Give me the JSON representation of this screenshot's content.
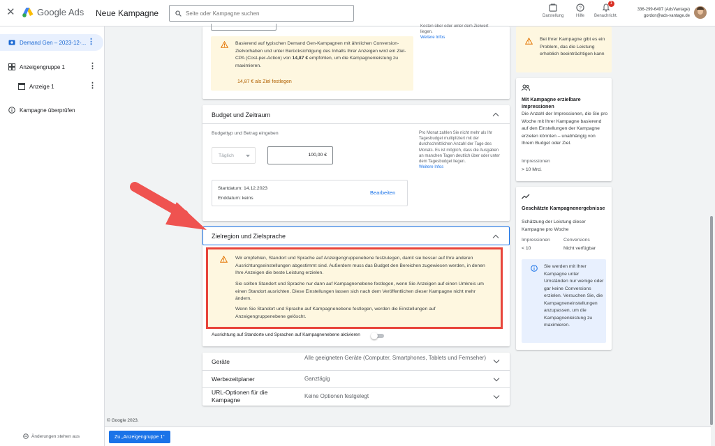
{
  "header": {
    "logo_text": "Google Ads",
    "page_title": "Neue Kampagne",
    "search_placeholder": "Seite oder Kampagne suchen",
    "tools": [
      {
        "label": "Darstellung",
        "icon": "display-icon"
      },
      {
        "label": "Hilfe",
        "icon": "help-icon"
      },
      {
        "label": "Benachricht.",
        "icon": "notifications-icon",
        "badge": "1"
      }
    ],
    "account_id": "336-299-6497 (AdsVantage)",
    "account_email": "gordon@ads-vantage.de"
  },
  "sidebar": {
    "items": [
      {
        "label": "Demand Gen – 2023-12-...",
        "icon": "campaign-icon",
        "active": true
      },
      {
        "label": "Anzeigengruppe 1",
        "icon": "ad-group-icon"
      },
      {
        "label": "Anzeige 1",
        "icon": "ad-icon"
      },
      {
        "label": "Kampagne überprüfen",
        "icon": "info-icon"
      }
    ],
    "footer": "Änderungen stehen aus"
  },
  "bidding": {
    "partial_top_text": "Kosten über oder unter dem Zielwert liegen.",
    "more_info": "Weitere Infos",
    "recommendation_pre": "Basierend auf typischen Demand Gen-Kampagnen mit ähnlichen Conversion-Zielvorhaben und unter Berücksichtigung des Inhalts Ihrer Anzeigen wird ein Ziel-CPA (Cost-per-Action) von",
    "recommendation_value": "14,87 €",
    "recommendation_post": "empfohlen, um die Kampagnenleistung zu maximieren.",
    "set_target_link": "14,87 € als Ziel festlegen"
  },
  "budget": {
    "title": "Budget und Zeitraum",
    "subtitle": "Budgettyp und Betrag eingeben",
    "type_value": "Täglich",
    "amount_value": "100,00 €",
    "side_help": "Pro Monat zahlen Sie nicht mehr als Ihr Tagesbudget multipliziert mit der durchschnittlichen Anzahl der Tage des Monats. Es ist möglich, dass die Ausgaben an manchen Tagen deutlich über oder unter dem Tagesbudget liegen.",
    "more_info": "Weitere Infos",
    "start_date": "Startdatum: 14.12.2023",
    "end_date": "Enddatum: keins",
    "edit_button": "Bearbeiten"
  },
  "targeting": {
    "title": "Zielregion und Zielsprache",
    "warning_p1": "Wir empfehlen, Standort und Sprache auf Anzeigengruppenebene festzulegen, damit sie besser auf Ihre anderen Ausrichtungseinstellungen abgestimmt sind. Außerdem muss das Budget den Bereichen zugewiesen werden, in denen Ihre Anzeigen die beste Leistung erzielen.",
    "warning_p2": "Sie sollten Standort und Sprache nur dann auf Kampagnenebene festlegen, wenn Sie Anzeigen auf einen Umkreis um einen Standort ausrichten. Diese Einstellungen lassen sich nach dem Veröffentlichen dieser Kampagne nicht mehr ändern.",
    "warning_p3": "Wenn Sie Standort und Sprache auf Kampagnenebene festlegen, werden die Einstellungen auf Anzeigengruppenebene gelöscht.",
    "toggle_label": "Ausrichtung auf Standorte und Sprachen auf Kampagnenebene aktivieren",
    "toggle_on": false
  },
  "collapsed_sections": [
    {
      "label": "Geräte",
      "value": "Alle geeigneten Geräte (Computer, Smartphones, Tablets und Fernseher)"
    },
    {
      "label": "Werbezeitplaner",
      "value": "Ganztägig"
    },
    {
      "label": "URL-Optionen für die Kampagne",
      "value": "Keine Optionen festgelegt"
    }
  ],
  "right_panel": {
    "warning": "Bei Ihrer Kampagne gibt es ein Problem, das die Leistung erheblich beeinträchtigen kann",
    "impressions_card": {
      "title": "Mit Kampagne erzielbare Impressionen",
      "description": "Die Anzahl der Impressionen, die Sie pro Woche mit Ihrer Kampagne basierend auf den Einstellungen der Kampagne erzielen könnten – unabhängig von Ihrem Budget oder Ziel.",
      "metric_label": "Impressionen",
      "metric_value": "> 10 Mrd."
    },
    "results_card": {
      "title": "Geschätzte Kampagnenergebnisse",
      "description": "Schätzung der Leistung dieser Kampagne pro Woche",
      "col1_label": "Impressionen",
      "col1_value": "< 10",
      "col2_label": "Conversions",
      "col2_value": "Nicht verfügbar",
      "info": "Sie werden mit Ihrer Kampagne unter Umständen nur wenige oder gar keine Conversions erzielen. Versuchen Sie, die Kampagneneinstellungen anzupassen, um die Kampagnenleistung zu maximieren."
    }
  },
  "footer": {
    "copyright": "© Google 2023.",
    "next_button": "Zu „Anzeigengruppe 1“"
  },
  "colors": {
    "accent": "#1a73e8",
    "warning_bg": "#fef7e0",
    "warning_icon": "#e37400",
    "highlight_border": "#e8453c",
    "annotation_arrow": "#ef5350"
  }
}
